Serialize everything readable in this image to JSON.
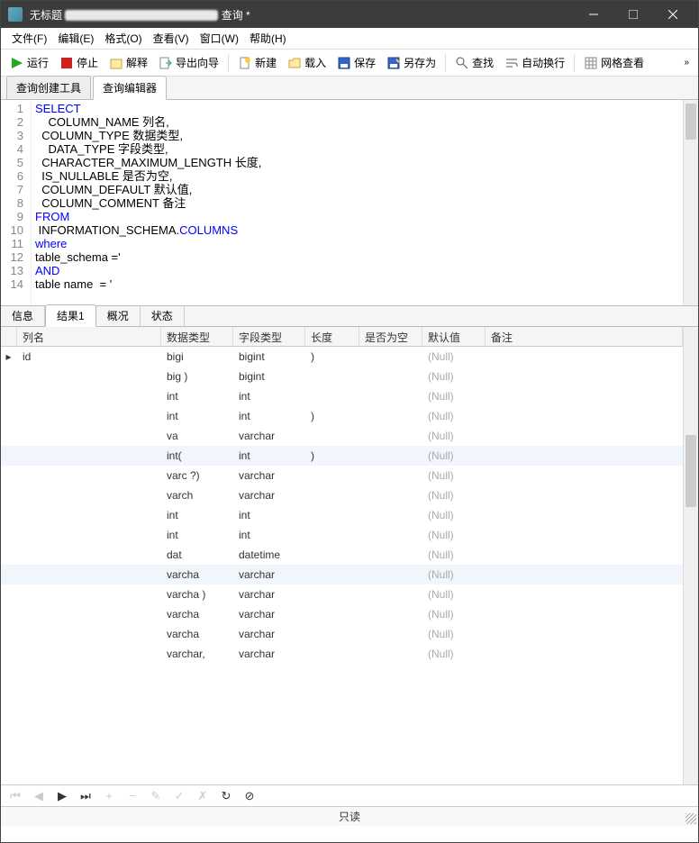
{
  "window": {
    "title_prefix": "无标题",
    "title_suffix": "查询 *"
  },
  "menu": {
    "file": "文件(F)",
    "edit": "编辑(E)",
    "format": "格式(O)",
    "view": "查看(V)",
    "window": "窗口(W)",
    "help": "帮助(H)"
  },
  "toolbar": {
    "run": "运行",
    "stop": "停止",
    "explain": "解释",
    "export_wizard": "导出向导",
    "new": "新建",
    "load": "载入",
    "save": "保存",
    "save_as": "另存为",
    "find": "查找",
    "auto_wrap": "自动换行",
    "grid_view": "网格查看"
  },
  "editor_tabs": {
    "builder": "查询创建工具",
    "editor": "查询编辑器"
  },
  "code_lines": [
    {
      "n": 1,
      "tokens": [
        {
          "t": "SELECT",
          "c": "kw"
        }
      ]
    },
    {
      "n": 2,
      "tokens": [
        {
          "t": "    COLUMN_NAME 列名,",
          "c": "ident"
        }
      ]
    },
    {
      "n": 3,
      "tokens": [
        {
          "t": "  COLUMN_TYPE 数据类型,",
          "c": "ident"
        }
      ]
    },
    {
      "n": 4,
      "tokens": [
        {
          "t": "    DATA_TYPE 字段类型,",
          "c": "ident"
        }
      ]
    },
    {
      "n": 5,
      "tokens": [
        {
          "t": "  CHARACTER_MAXIMUM_LENGTH 长度,",
          "c": "ident"
        }
      ]
    },
    {
      "n": 6,
      "tokens": [
        {
          "t": "  IS_NULLABLE 是否为空,",
          "c": "ident"
        }
      ]
    },
    {
      "n": 7,
      "tokens": [
        {
          "t": "  COLUMN_DEFAULT 默认值,",
          "c": "ident"
        }
      ]
    },
    {
      "n": 8,
      "tokens": [
        {
          "t": "  COLUMN_COMMENT 备注",
          "c": "ident"
        }
      ]
    },
    {
      "n": 9,
      "tokens": [
        {
          "t": "FROM",
          "c": "kw"
        }
      ]
    },
    {
      "n": 10,
      "tokens": [
        {
          "t": " INFORMATION_SCHEMA.",
          "c": "ident"
        },
        {
          "t": "COLUMNS",
          "c": "col"
        }
      ]
    },
    {
      "n": 11,
      "tokens": [
        {
          "t": "where",
          "c": "kw"
        }
      ]
    },
    {
      "n": 12,
      "tokens": [
        {
          "t": "table_schema ='",
          "c": "ident"
        }
      ]
    },
    {
      "n": 13,
      "tokens": [
        {
          "t": "AND",
          "c": "kw"
        }
      ]
    },
    {
      "n": 14,
      "tokens": [
        {
          "t": "table name  = '",
          "c": "ident"
        }
      ]
    }
  ],
  "result_tabs": {
    "info": "信息",
    "result1": "结果1",
    "profile": "概况",
    "status": "状态"
  },
  "grid": {
    "headers": {
      "colname": "列名",
      "datatype": "数据类型",
      "fieldtype": "字段类型",
      "length": "长度",
      "nullable": "是否为空",
      "default": "默认值",
      "remark": "备注"
    },
    "rows": [
      {
        "name": "id",
        "dtype": "bigi",
        "ftype": "bigint",
        "len": ")",
        "null": "",
        "def": "(Null)",
        "rem": ""
      },
      {
        "name": "",
        "dtype": "big      )",
        "ftype": "bigint",
        "len": "",
        "null": "",
        "def": "(Null)",
        "rem": ""
      },
      {
        "name": "",
        "dtype": "int",
        "ftype": "int",
        "len": "",
        "null": "",
        "def": "(Null)",
        "rem": ""
      },
      {
        "name": "",
        "dtype": "int",
        "ftype": "int",
        "len": ")",
        "null": "",
        "def": "(Null)",
        "rem": ""
      },
      {
        "name": "",
        "dtype": "va",
        "ftype": "varchar",
        "len": "",
        "null": "",
        "def": "(Null)",
        "rem": ""
      },
      {
        "name": "",
        "dtype": "int(",
        "ftype": "int",
        "len": ")",
        "null": "",
        "def": "(Null)",
        "rem": ""
      },
      {
        "name": "",
        "dtype": "varc     ?)",
        "ftype": "varchar",
        "len": "",
        "null": "",
        "def": "(Null)",
        "rem": ""
      },
      {
        "name": "",
        "dtype": "varch",
        "ftype": "varchar",
        "len": "",
        "null": "",
        "def": "(Null)",
        "rem": ""
      },
      {
        "name": "",
        "dtype": "int",
        "ftype": "int",
        "len": "",
        "null": "",
        "def": "(Null)",
        "rem": ""
      },
      {
        "name": "",
        "dtype": "int",
        "ftype": "int",
        "len": "",
        "null": "",
        "def": "(Null)",
        "rem": ""
      },
      {
        "name": "",
        "dtype": "dat",
        "ftype": "datetime",
        "len": "",
        "null": "",
        "def": "(Null)",
        "rem": ""
      },
      {
        "name": "",
        "dtype": "varcha",
        "ftype": "varchar",
        "len": "",
        "null": "",
        "def": "(Null)",
        "rem": ""
      },
      {
        "name": "",
        "dtype": "varcha    )",
        "ftype": "varchar",
        "len": "",
        "null": "",
        "def": "(Null)",
        "rem": ""
      },
      {
        "name": "",
        "dtype": "varcha",
        "ftype": "varchar",
        "len": "",
        "null": "",
        "def": "(Null)",
        "rem": ""
      },
      {
        "name": "",
        "dtype": "varcha",
        "ftype": "varchar",
        "len": "",
        "null": "",
        "def": "(Null)",
        "rem": ""
      },
      {
        "name": "",
        "dtype": "varchar,",
        "ftype": "varchar",
        "len": "",
        "null": "",
        "def": "(Null)",
        "rem": ""
      }
    ]
  },
  "statusbar": {
    "readonly": "只读"
  }
}
